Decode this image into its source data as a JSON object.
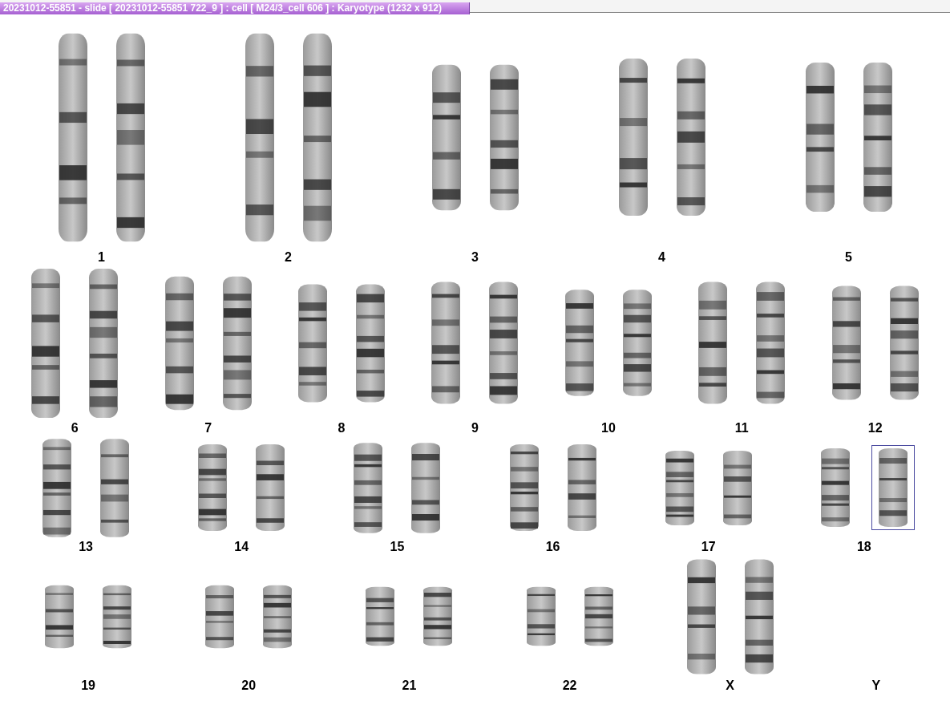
{
  "window": {
    "title": "20231012-55851 - slide [ 20231012-55851 722_9 ] : cell [ M24/3_cell 606 ] : Karyotype  (1232 x 912)"
  },
  "karyotype": {
    "rows": [
      {
        "groups": [
          {
            "label": "1",
            "chromosomes": [
              {
                "selected": false
              },
              {
                "selected": false
              }
            ]
          },
          {
            "label": "2",
            "chromosomes": [
              {
                "selected": false
              },
              {
                "selected": false
              }
            ]
          },
          {
            "label": "3",
            "chromosomes": [
              {
                "selected": false
              },
              {
                "selected": false
              }
            ]
          },
          {
            "label": "4",
            "chromosomes": [
              {
                "selected": false
              },
              {
                "selected": false
              }
            ]
          },
          {
            "label": "5",
            "chromosomes": [
              {
                "selected": false
              },
              {
                "selected": false
              }
            ]
          }
        ]
      },
      {
        "groups": [
          {
            "label": "6",
            "chromosomes": [
              {
                "selected": false
              },
              {
                "selected": false
              }
            ]
          },
          {
            "label": "7",
            "chromosomes": [
              {
                "selected": false
              },
              {
                "selected": false
              }
            ]
          },
          {
            "label": "8",
            "chromosomes": [
              {
                "selected": false
              },
              {
                "selected": false
              }
            ]
          },
          {
            "label": "9",
            "chromosomes": [
              {
                "selected": false
              },
              {
                "selected": false
              }
            ]
          },
          {
            "label": "10",
            "chromosomes": [
              {
                "selected": false
              },
              {
                "selected": false
              }
            ]
          },
          {
            "label": "11",
            "chromosomes": [
              {
                "selected": false
              },
              {
                "selected": false
              }
            ]
          },
          {
            "label": "12",
            "chromosomes": [
              {
                "selected": false
              },
              {
                "selected": false
              }
            ]
          }
        ]
      },
      {
        "groups": [
          {
            "label": "13",
            "chromosomes": [
              {
                "selected": false
              },
              {
                "selected": false
              }
            ]
          },
          {
            "label": "14",
            "chromosomes": [
              {
                "selected": false
              },
              {
                "selected": false
              }
            ]
          },
          {
            "label": "15",
            "chromosomes": [
              {
                "selected": false
              },
              {
                "selected": false
              }
            ]
          },
          {
            "label": "16",
            "chromosomes": [
              {
                "selected": false
              },
              {
                "selected": false
              }
            ]
          },
          {
            "label": "17",
            "chromosomes": [
              {
                "selected": false
              },
              {
                "selected": false
              }
            ]
          },
          {
            "label": "18",
            "chromosomes": [
              {
                "selected": false
              },
              {
                "selected": true
              }
            ]
          }
        ]
      },
      {
        "groups": [
          {
            "label": "19",
            "chromosomes": [
              {
                "selected": false
              },
              {
                "selected": false
              }
            ]
          },
          {
            "label": "20",
            "chromosomes": [
              {
                "selected": false
              },
              {
                "selected": false
              }
            ]
          },
          {
            "label": "21",
            "chromosomes": [
              {
                "selected": false
              },
              {
                "selected": false
              }
            ]
          },
          {
            "label": "22",
            "chromosomes": [
              {
                "selected": false
              },
              {
                "selected": false
              }
            ]
          },
          {
            "label": "X",
            "chromosomes": [
              {
                "selected": false
              },
              {
                "selected": false
              }
            ]
          },
          {
            "label": "Y"
          }
        ]
      }
    ]
  }
}
